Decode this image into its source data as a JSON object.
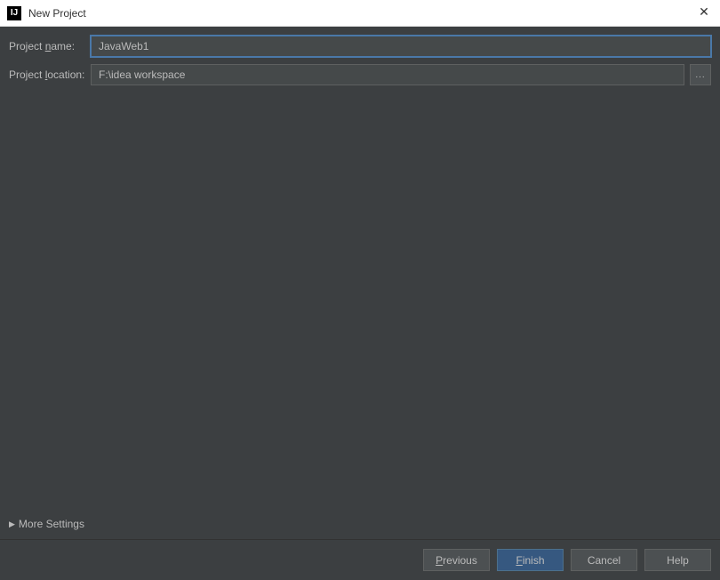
{
  "window": {
    "title": "New Project",
    "icon_text": "IJ"
  },
  "form": {
    "project_name_label_pre": "Project ",
    "project_name_label_u": "n",
    "project_name_label_post": "ame:",
    "project_name_value": "JavaWeb1",
    "project_location_label_pre": "Project ",
    "project_location_label_u": "l",
    "project_location_label_post": "ocation:",
    "project_location_value": "F:\\idea workspace",
    "browse_label": "..."
  },
  "more_settings_label": "More Settings",
  "buttons": {
    "previous_u": "P",
    "previous_post": "revious",
    "finish_u": "F",
    "finish_post": "inish",
    "cancel": "Cancel",
    "help": "Help"
  }
}
